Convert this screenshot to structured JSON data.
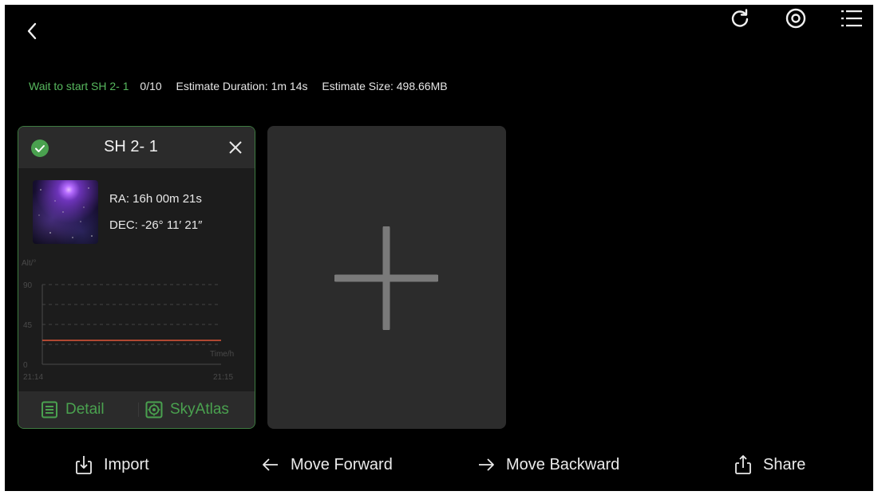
{
  "colors": {
    "accent_green": "#4aa14f",
    "status_green": "#57b85e",
    "background": "#000000",
    "card_bg": "#1c1c1c",
    "plot_line": "#e2563a"
  },
  "topbar": {
    "back_icon": "chevron-left-icon",
    "icons": [
      "refresh-icon",
      "settings-icon",
      "list-icon"
    ]
  },
  "status": {
    "wait_text": "Wait to start SH 2- 1",
    "progress": "0/10",
    "duration": "Estimate Duration: 1m 14s",
    "size": "Estimate Size: 498.66MB"
  },
  "target_card": {
    "title": "SH 2- 1",
    "selected": true,
    "ra": "RA: 16h 00m 21s",
    "dec": "DEC: -26° 11′ 21″",
    "thumbnail_icon": "nebula-thumbnail",
    "detail_label": "Detail",
    "skyatlas_label": "SkyAtlas"
  },
  "chart_data": {
    "type": "line",
    "ylabel": "Alt/°",
    "xlabel": "Time/h",
    "ylim": [
      0,
      90
    ],
    "yticks": [
      "90",
      "45",
      "0"
    ],
    "xticks": [
      "21:14",
      "21:15"
    ],
    "grid": true,
    "series": [
      {
        "x": [
          "21:14",
          "21:15"
        ],
        "values": [
          27,
          27
        ]
      }
    ]
  },
  "add_card": {
    "icon": "plus-icon"
  },
  "bottombar": {
    "import": "Import",
    "move_forward": "Move Forward",
    "move_backward": "Move Backward",
    "share": "Share"
  }
}
